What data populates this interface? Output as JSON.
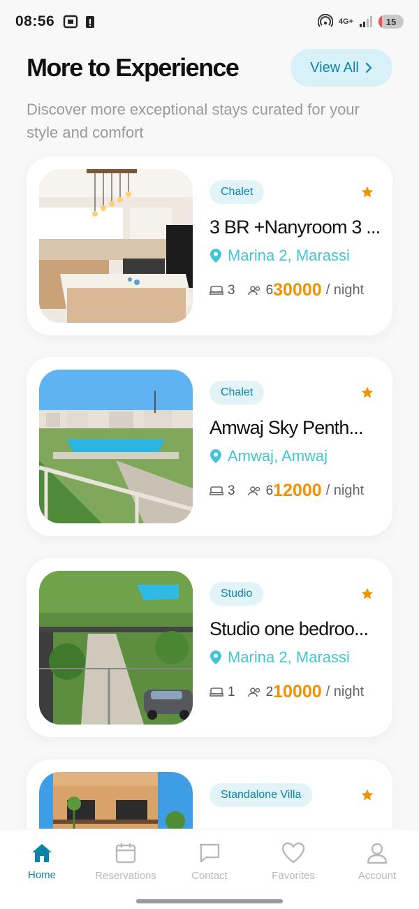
{
  "status": {
    "time": "08:56",
    "network": "4G+",
    "battery": "15",
    "battery_level": 0.15
  },
  "header": {
    "title": "More to Experience",
    "view_all": "View All",
    "subtitle": "Discover more exceptional stays curated for your style and comfort"
  },
  "listings": [
    {
      "type": "Chalet",
      "title": "3 BR +Nanyroom 3 ...",
      "location": "Marina 2, Marassi",
      "beds": "3",
      "guests_prefix": "6",
      "price": "30000",
      "per": "/ night"
    },
    {
      "type": "Chalet",
      "title": "Amwaj Sky Penth...",
      "location": "Amwaj, Amwaj",
      "beds": "3",
      "guests_prefix": "6",
      "price": "12000",
      "per": "/ night"
    },
    {
      "type": "Studio",
      "title": "Studio one bedroo...",
      "location": "Marina 2, Marassi",
      "beds": "1",
      "guests_prefix": "2",
      "price": "10000",
      "per": "/ night"
    },
    {
      "type": "Standalone Villa",
      "title": "",
      "location": "",
      "beds": "",
      "guests_prefix": "",
      "price": "",
      "per": ""
    }
  ],
  "nav": [
    {
      "label": "Home",
      "icon": "home-icon",
      "active": true
    },
    {
      "label": "Reservations",
      "icon": "calendar-icon",
      "active": false
    },
    {
      "label": "Contact",
      "icon": "chat-icon",
      "active": false
    },
    {
      "label": "Favorites",
      "icon": "heart-icon",
      "active": false
    },
    {
      "label": "Account",
      "icon": "person-icon",
      "active": false
    }
  ],
  "colors": {
    "accent": "#0a84a8",
    "price": "#f39200",
    "location": "#41c4d6",
    "star": "#f39200"
  }
}
